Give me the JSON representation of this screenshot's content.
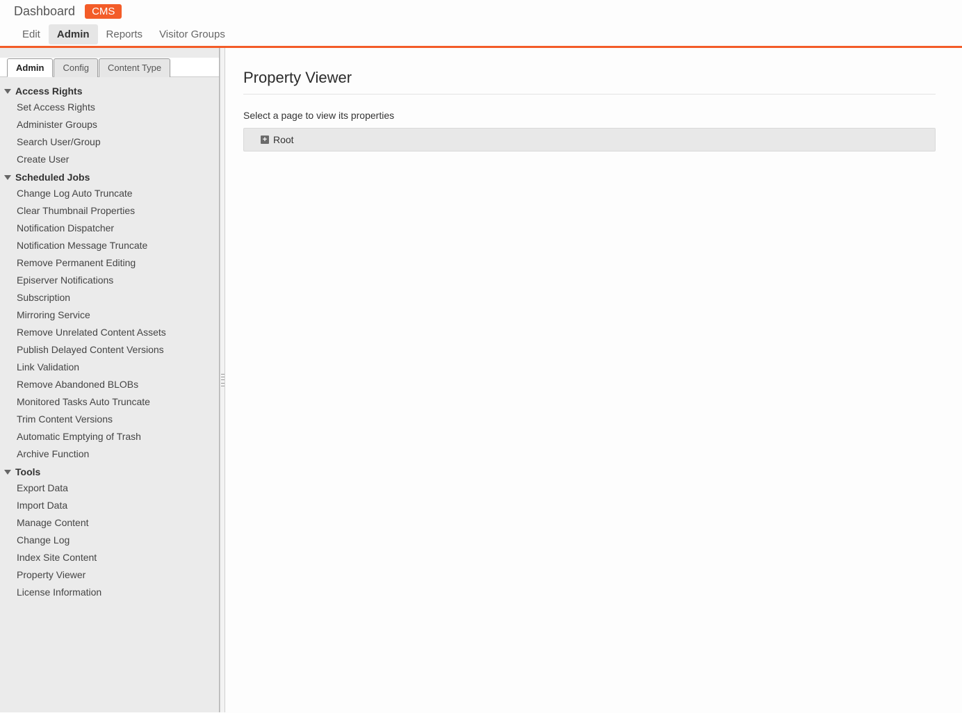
{
  "header": {
    "title": "Dashboard",
    "badge": "CMS",
    "nav": {
      "edit": "Edit",
      "admin": "Admin",
      "reports": "Reports",
      "visitor_groups": "Visitor Groups"
    }
  },
  "sidebar": {
    "tabs": {
      "admin": "Admin",
      "config": "Config",
      "content_type": "Content Type"
    },
    "groups": {
      "access_rights": {
        "title": "Access Rights",
        "items": [
          "Set Access Rights",
          "Administer Groups",
          "Search User/Group",
          "Create User"
        ]
      },
      "scheduled_jobs": {
        "title": "Scheduled Jobs",
        "items": [
          "Change Log Auto Truncate",
          "Clear Thumbnail Properties",
          "Notification Dispatcher",
          "Notification Message Truncate",
          "Remove Permanent Editing",
          "Episerver Notifications",
          "Subscription",
          "Mirroring Service",
          "Remove Unrelated Content Assets",
          "Publish Delayed Content Versions",
          "Link Validation",
          "Remove Abandoned BLOBs",
          "Monitored Tasks Auto Truncate",
          "Trim Content Versions",
          "Automatic Emptying of Trash",
          "Archive Function"
        ]
      },
      "tools": {
        "title": "Tools",
        "items": [
          "Export Data",
          "Import Data",
          "Manage Content",
          "Change Log",
          "Index Site Content",
          "Property Viewer",
          "License Information"
        ]
      }
    }
  },
  "main": {
    "heading": "Property Viewer",
    "helper": "Select a page to view its properties",
    "tree": {
      "root_label": "Root",
      "expand_glyph": "+"
    }
  }
}
